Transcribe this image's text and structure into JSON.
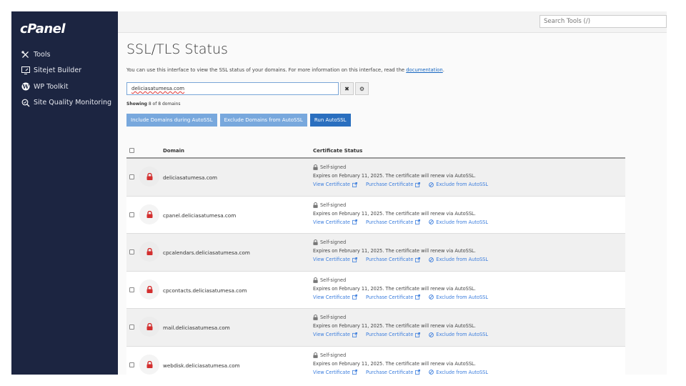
{
  "brand": "cPanel",
  "sidebar": {
    "items": [
      {
        "label": "Tools",
        "icon": "tools-icon"
      },
      {
        "label": "Sitejet Builder",
        "icon": "sitejet-icon"
      },
      {
        "label": "WP Toolkit",
        "icon": "wordpress-icon"
      },
      {
        "label": "Site Quality Monitoring",
        "icon": "site-quality-icon"
      }
    ]
  },
  "header": {
    "search_placeholder": "Search Tools (/)"
  },
  "page": {
    "title": "SSL/TLS Status",
    "description": "You can use this interface to view the SSL status of your domains. For more information on this interface, read the ",
    "doc_link": "documentation",
    "doc_suffix": "."
  },
  "filter": {
    "value": "deliciasatumesa.com",
    "clear_label": "✖",
    "settings_label": "⚙"
  },
  "showing": {
    "label": "Showing",
    "text": "8 of 8 domains"
  },
  "buttons": {
    "include": "Include Domains during AutoSSL",
    "exclude": "Exclude Domains from AutoSSL",
    "run": "Run AutoSSL"
  },
  "table": {
    "columns": {
      "domain": "Domain",
      "status": "Certificate Status"
    },
    "rows": [
      {
        "domain": "deliciasatumesa.com",
        "status": "Self-signed",
        "expiry": "Expires on February 11, 2025. The certificate will renew via AutoSSL.",
        "view": "View Certificate",
        "purchase": "Purchase Certificate",
        "exclude": "Exclude from AutoSSL"
      },
      {
        "domain": "cpanel.deliciasatumesa.com",
        "status": "Self-signed",
        "expiry": "Expires on February 11, 2025. The certificate will renew via AutoSSL.",
        "view": "View Certificate",
        "purchase": "Purchase Certificate",
        "exclude": "Exclude from AutoSSL"
      },
      {
        "domain": "cpcalendars.deliciasatumesa.com",
        "status": "Self-signed",
        "expiry": "Expires on February 11, 2025. The certificate will renew via AutoSSL.",
        "view": "View Certificate",
        "purchase": "Purchase Certificate",
        "exclude": "Exclude from AutoSSL"
      },
      {
        "domain": "cpcontacts.deliciasatumesa.com",
        "status": "Self-signed",
        "expiry": "Expires on February 11, 2025. The certificate will renew via AutoSSL.",
        "view": "View Certificate",
        "purchase": "Purchase Certificate",
        "exclude": "Exclude from AutoSSL"
      },
      {
        "domain": "mail.deliciasatumesa.com",
        "status": "Self-signed",
        "expiry": "Expires on February 11, 2025. The certificate will renew via AutoSSL.",
        "view": "View Certificate",
        "purchase": "Purchase Certificate",
        "exclude": "Exclude from AutoSSL"
      },
      {
        "domain": "webdisk.deliciasatumesa.com",
        "status": "Self-signed",
        "expiry": "Expires on February 11, 2025. The certificate will renew via AutoSSL.",
        "view": "View Certificate",
        "purchase": "Purchase Certificate",
        "exclude": "Exclude from AutoSSL"
      }
    ]
  },
  "colors": {
    "sidebar": "#1c2541",
    "primary": "#2a6fbf",
    "secondary": "#78a8dd",
    "lock": "#d32f2f",
    "link": "#3b7ddd"
  }
}
